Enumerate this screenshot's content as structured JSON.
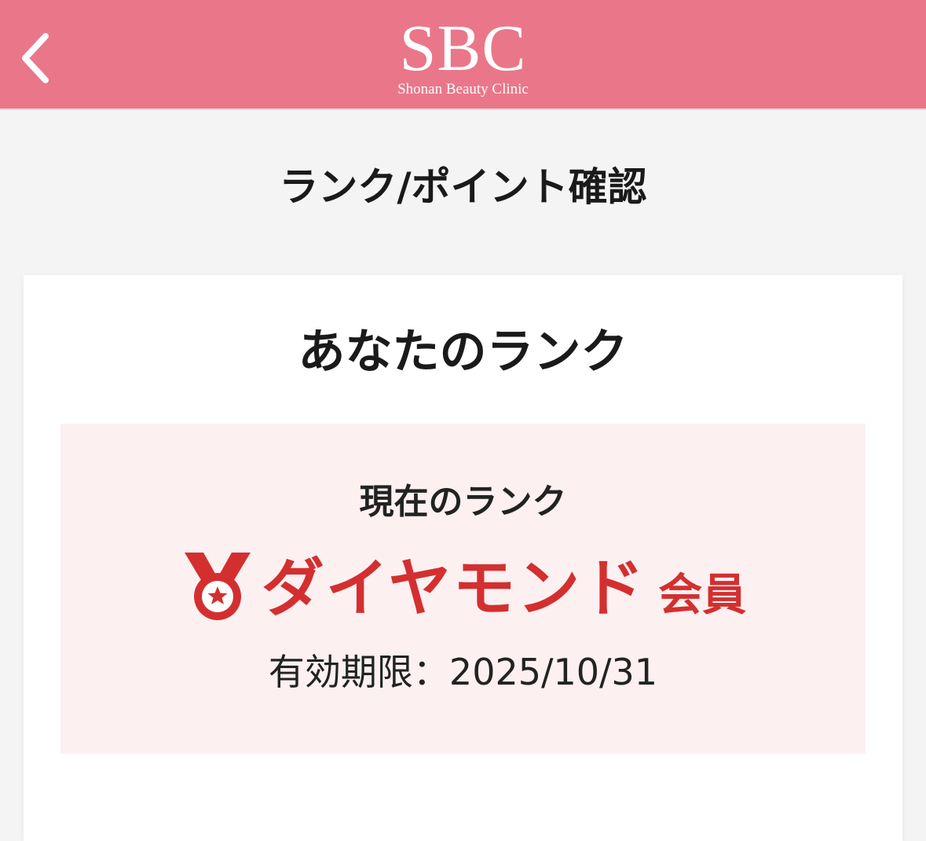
{
  "header": {
    "logo_main": "SBC",
    "logo_sub": "Shonan Beauty Clinic",
    "bg_color": "#e97789"
  },
  "page": {
    "title": "ランク/ポイント確認"
  },
  "rank_card": {
    "title": "あなたのランク",
    "current_label": "現在のランク",
    "rank_name": "ダイヤモンド",
    "rank_suffix": "会員",
    "expiry_text": "有効期限：2025/10/31",
    "accent_color": "#d42f2f",
    "box_bg": "#fcf0f1"
  },
  "icons": {
    "back": "chevron-left-icon",
    "medal": "medal-star-icon"
  }
}
